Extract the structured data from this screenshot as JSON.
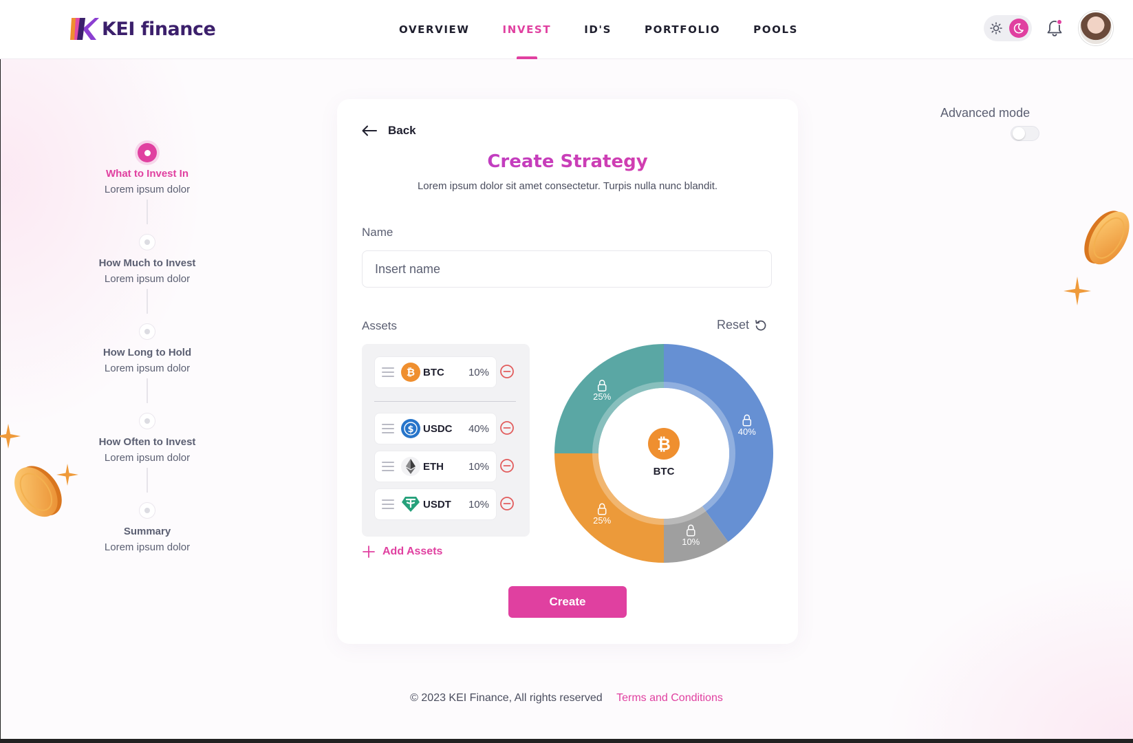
{
  "brand": {
    "name": "KEI finance",
    "accent": "#e040a0"
  },
  "nav": {
    "items": [
      {
        "label": "OVERVIEW"
      },
      {
        "label": "INVEST"
      },
      {
        "label": "ID'S"
      },
      {
        "label": "PORTFOLIO"
      },
      {
        "label": "POOLS"
      }
    ],
    "active": "INVEST"
  },
  "header_icons": [
    "sun-icon",
    "moon-icon",
    "bell-icon",
    "avatar"
  ],
  "steps": [
    {
      "title": "What to Invest In",
      "subtitle": "Lorem ipsum dolor",
      "active": true
    },
    {
      "title": "How Much to Invest",
      "subtitle": "Lorem ipsum dolor",
      "active": false
    },
    {
      "title": "How Long to Hold",
      "subtitle": "Lorem ipsum dolor",
      "active": false
    },
    {
      "title": "How Often to Invest",
      "subtitle": "Lorem ipsum dolor",
      "active": false
    },
    {
      "title": "Summary",
      "subtitle": "Lorem ipsum dolor",
      "active": false
    }
  ],
  "card": {
    "back_label": "Back",
    "title": "Create Strategy",
    "subtitle": "Lorem ipsum dolor sit amet consectetur. Turpis nulla nunc blandit.",
    "name_label": "Name",
    "name_placeholder": "Insert name",
    "name_value": "",
    "assets_label": "Assets",
    "reset_label": "Reset",
    "add_assets_label": "Add Assets",
    "create_label": "Create"
  },
  "assets": [
    {
      "symbol": "BTC",
      "percent": "10%",
      "icon": "btc-icon",
      "color": "#ef8f2f"
    },
    {
      "symbol": "USDC",
      "percent": "40%",
      "icon": "usdc-icon",
      "color": "#2775ca"
    },
    {
      "symbol": "ETH",
      "percent": "10%",
      "icon": "eth-icon",
      "color": "#3c3c3d"
    },
    {
      "symbol": "USDT",
      "percent": "10%",
      "icon": "usdt-icon",
      "color": "#26a17b"
    }
  ],
  "allocation_chart": {
    "center_label": "BTC",
    "segments": [
      {
        "label": "40%",
        "value": 40,
        "color": "#6690d3"
      },
      {
        "label": "10%",
        "value": 10,
        "color": "#9f9f9f"
      },
      {
        "label": "25%",
        "value": 25,
        "color": "#ec9a3a"
      },
      {
        "label": "25%",
        "value": 25,
        "color": "#5aa7a4"
      }
    ]
  },
  "advanced_mode": {
    "label": "Advanced mode",
    "enabled": false
  },
  "footer": {
    "copyright": "© 2023 KEI Finance, All rights reserved",
    "terms": "Terms and Conditions"
  }
}
